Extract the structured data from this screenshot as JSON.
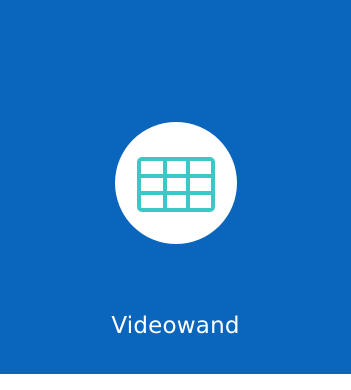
{
  "tile": {
    "label": "Videowand",
    "background_color": "#0a65bd",
    "icon": "videowall-grid-icon",
    "icon_color": "#3ec7c7"
  }
}
